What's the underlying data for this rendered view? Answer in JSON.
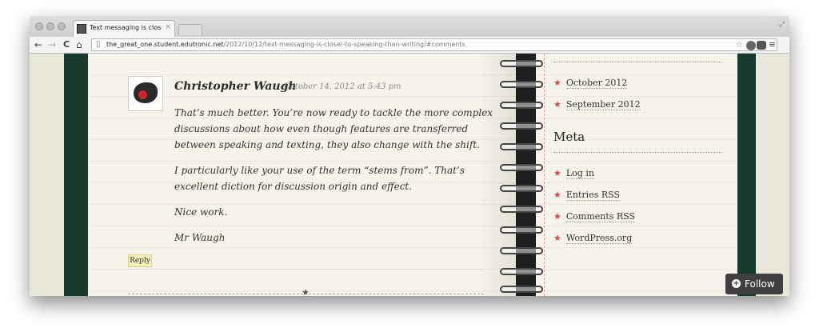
{
  "browser": {
    "tab": {
      "title": "Text messaging is closer to",
      "close_glyph": "×"
    },
    "toolbar": {
      "back_glyph": "←",
      "forward_glyph": "→",
      "reload_glyph": "C",
      "home_glyph": "⌂"
    },
    "url": {
      "host": "the_great_one.student.edutronic.net",
      "path": "/2012/10/12/text-messaging-is-closer-to-speaking-than-writing/#comments"
    },
    "icons": [
      "page-icon",
      "bookmark-star-icon",
      "extension-icon",
      "pocket-icon",
      "menu-icon",
      "fullscreen-icon"
    ]
  },
  "comment": {
    "author": "Christopher Waugh",
    "date": "October 14, 2012 at 5:43 pm",
    "paragraphs": [
      [
        "That’s much better. You’re now ready to tackle the more complex",
        "discussions about how even though features are transferred",
        "between speaking and texting, they also change with the shift."
      ],
      [
        "I particularly like your use of the term “stems from”. That’s",
        "excellent diction for discussion origin and effect."
      ],
      [
        "Nice work."
      ],
      [
        "Mr Waugh"
      ]
    ],
    "reply_label": "Reply"
  },
  "sidebar": {
    "archives": [
      {
        "label": "October 2012"
      },
      {
        "label": "September 2012"
      }
    ],
    "meta_heading": "Meta",
    "meta_links": [
      {
        "label": "Log in"
      },
      {
        "label": "Entries RSS"
      },
      {
        "label": "Comments RSS"
      },
      {
        "label": "WordPress.org"
      }
    ]
  },
  "follow": {
    "label": "Follow",
    "icon_glyph": "+"
  },
  "colors": {
    "accent_star": "#d8474a",
    "binding": "#173a2c",
    "follow_bg": "#404040",
    "reply_bg": "#f5efb8"
  }
}
